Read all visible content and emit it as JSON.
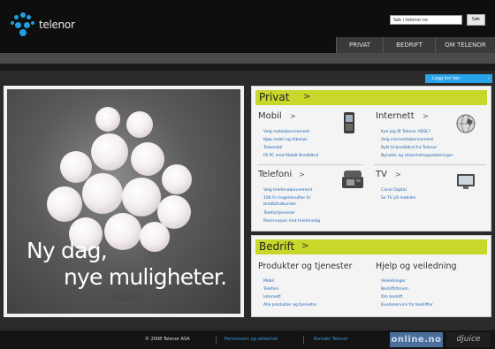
{
  "header": {
    "logo_text": "telenor",
    "search_value": "Søk i telenor.no",
    "search_button": "Søk",
    "nav": [
      {
        "label": "PRIVAT"
      },
      {
        "label": "BEDRIFT"
      },
      {
        "label": "OM TELENOR"
      }
    ],
    "login_label": "Logg inn her",
    "login_arrow": "›"
  },
  "hero": {
    "line1": "Ny dag,",
    "line2": "nye muligheter."
  },
  "privat": {
    "title": "Privat",
    "arrow": ">",
    "sections": {
      "mobil": {
        "title": "Mobil",
        "arrow": ">",
        "links": [
          "Velg mobilabonnement",
          "Kjøp mobil og tilbehør",
          "Telemobil",
          "Få PC med Mobilt Bredbånd"
        ]
      },
      "internett": {
        "title": "Internett",
        "arrow": ">",
        "links": [
          "Kan jeg få Telenor ADSL?",
          "Velg internettabonnement",
          "Bytt til bredbånd fra Telenor",
          "Nyheter og sikkerhetsoppdateringer"
        ]
      },
      "telefoni": {
        "title": "Telefoni",
        "arrow": ">",
        "links": [
          "Velg telefonabonnement",
          "100 fri ringeminutter til",
          "bredbåndkunder",
          "Telefontjenester",
          "Reservasjon mot telefonsalg"
        ]
      },
      "tv": {
        "title": "TV",
        "arrow": ">",
        "links": [
          "Canal Digital",
          "Se TV på mobilen"
        ]
      }
    }
  },
  "bedrift": {
    "title": "Bedrift",
    "arrow": ">",
    "sections": {
      "produkter": {
        "title": "Produkter og tjenester",
        "links": [
          "Mobil",
          "Telefoni",
          "Internett",
          "Alle produkter og tjenester"
        ]
      },
      "hjelp": {
        "title": "Hjelp og veiledning",
        "links": [
          "Veiledninger",
          "Bedriftsforum",
          "Om bedrift",
          "Kundeservice for bedrifter"
        ]
      }
    }
  },
  "footer": {
    "copyright": "© 2008 Telenor ASA",
    "privacy": "Personvern og sikkerhet",
    "contact": "Kontakt Telenor",
    "badge_online": "online.no",
    "badge_djuice": "djuice"
  },
  "colors": {
    "accent_green": "#c8d82a",
    "accent_blue": "#2aa4e8",
    "link": "#1d63b0"
  },
  "icons": [
    "telenor-logo-icon",
    "mobile-phone-icon",
    "globe-icon",
    "desk-phone-icon",
    "tv-icon"
  ]
}
